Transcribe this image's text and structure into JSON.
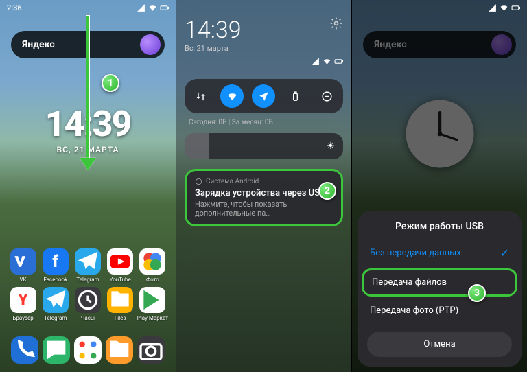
{
  "p1": {
    "status_time": "2:36",
    "search_label": "Яндекс",
    "clock_time": "14:39",
    "clock_date": "ВС, 21 МАРТА",
    "badge": "1",
    "apps": [
      {
        "name": "VK",
        "label": "VK",
        "bg": "#2a6fd6"
      },
      {
        "name": "Facebook",
        "label": "Facebook",
        "bg": "#1877f2"
      },
      {
        "name": "Telegram",
        "label": "Telegram",
        "bg": "#29a9eb"
      },
      {
        "name": "YouTube",
        "label": "YouTube",
        "bg": "#ffffff"
      },
      {
        "name": "Photos",
        "label": "Фото",
        "bg": "#ffffff"
      },
      {
        "name": "Browser",
        "label": "Браузер",
        "bg": "#ffffff"
      },
      {
        "name": "Telegram2",
        "label": "Telegram",
        "bg": "#29a9eb"
      },
      {
        "name": "Clock",
        "label": "Часы",
        "bg": "#3a3a3e"
      },
      {
        "name": "Files",
        "label": "Files",
        "bg": "#ffb300"
      },
      {
        "name": "PlayStore",
        "label": "Play Маркет",
        "bg": "#ffffff"
      }
    ],
    "dock": [
      {
        "name": "Phone",
        "bg": "#1f6fd6"
      },
      {
        "name": "Messages",
        "bg": "#2db56a"
      },
      {
        "name": "AppDrawer",
        "bg": "#ffffff"
      },
      {
        "name": "FileManager",
        "bg": "#ff9b2a"
      },
      {
        "name": "Camera",
        "bg": "#3a3a3e"
      }
    ]
  },
  "p2": {
    "shade_time": "14:39",
    "shade_date": "Вс, 21 марта",
    "usage": "Сегодня: 0Б   |   За месяц: 0Б",
    "notif_source": "Система Android",
    "notif_title": "Зарядка устройства через USB…",
    "notif_body": "Нажмите, чтобы показать дополнительные па…",
    "badge": "2"
  },
  "p3": {
    "search_label": "Яндекс",
    "sheet_title": "Режим работы USB",
    "opt_none": "Без передачи данных",
    "opt_files": "Передача файлов",
    "opt_ptp": "Передача фото (PTP)",
    "cancel": "Отмена",
    "badge": "3"
  }
}
